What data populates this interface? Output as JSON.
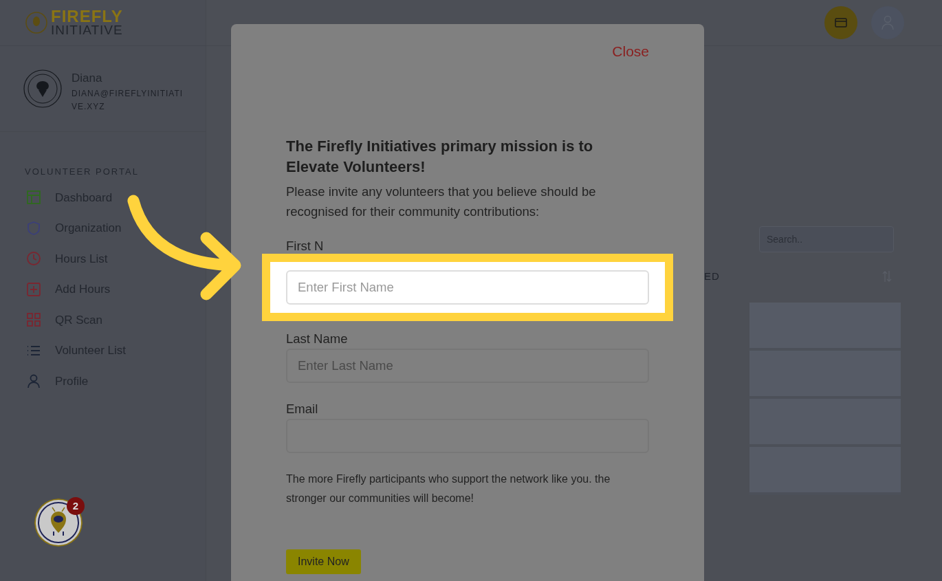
{
  "logo": {
    "line_1": "FIREFLY",
    "line_2": "INITIATIVE"
  },
  "user": {
    "name": "Diana",
    "email": "DIANA@FIREFLYINITIATIVE.XYZ"
  },
  "sidebar": {
    "heading": "VOLUNTEER PORTAL",
    "items": [
      {
        "label": "Dashboard",
        "kind": "layout",
        "color": "#2f6a1f"
      },
      {
        "label": "Organization",
        "kind": "shield",
        "color": "#3b3f7a"
      },
      {
        "label": "Hours List",
        "kind": "clock",
        "color": "#7a2630"
      },
      {
        "label": "Add Hours",
        "kind": "plus",
        "color": "#7a2630"
      },
      {
        "label": "QR Scan",
        "kind": "grid",
        "color": "#7a2630"
      },
      {
        "label": "Volunteer List",
        "kind": "list",
        "color": "#1c2536"
      },
      {
        "label": "Profile",
        "kind": "person",
        "color": "#1c2536"
      }
    ]
  },
  "assistant": {
    "badge": "2"
  },
  "search": {
    "placeholder": "Search.."
  },
  "table": {
    "column_3": "ED"
  },
  "modal": {
    "close": "Close",
    "title": "The Firefly Initiatives primary mission is to Elevate Volunteers!",
    "intro": "Please invite any volunteers that you believe should be recognised for their community contributions:",
    "fields": [
      {
        "label": "First N",
        "placeholder": "Enter First Name",
        "highlighted": true
      },
      {
        "label": "Last Name",
        "placeholder": "Enter Last Name",
        "highlighted": false
      },
      {
        "label": "Email",
        "highlighted": false
      }
    ],
    "note": "The more Firefly participants who support the network like you. the stronger our communities will become!",
    "button": "Invite Now"
  }
}
